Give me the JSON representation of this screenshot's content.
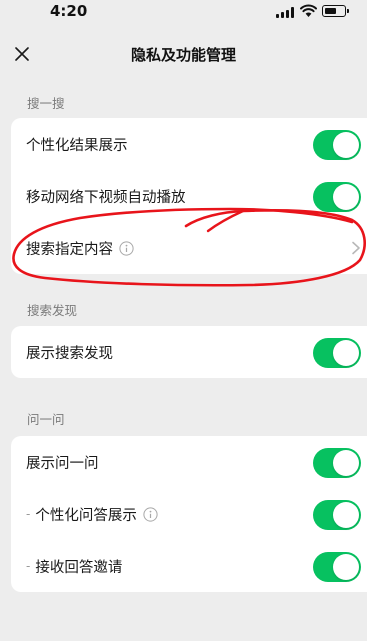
{
  "status_bar": {
    "time": "4:20",
    "signal_icon": "signal-icon",
    "wifi_icon": "wifi-icon",
    "battery_icon": "battery-icon",
    "battery_level": 0.6
  },
  "nav": {
    "title": "隐私及功能管理",
    "close_icon": "close-icon"
  },
  "sections": [
    {
      "header": "搜一搜",
      "rows": [
        {
          "label": "个性化结果展示",
          "control": "toggle",
          "on": true
        },
        {
          "label": "移动网络下视频自动播放",
          "control": "toggle",
          "on": true
        },
        {
          "label": "搜索指定内容",
          "control": "chevron",
          "info_icon": true
        }
      ]
    },
    {
      "header": "搜索发现",
      "rows": [
        {
          "label": "展示搜索发现",
          "control": "toggle",
          "on": true
        }
      ]
    },
    {
      "header": "问一问",
      "rows": [
        {
          "label": "展示问一问",
          "control": "toggle",
          "on": true
        },
        {
          "prefix": "-",
          "label": "个性化问答展示",
          "control": "toggle",
          "on": true,
          "info_icon": true
        },
        {
          "prefix": "-",
          "label": "接收回答邀请",
          "control": "toggle",
          "on": true
        }
      ]
    }
  ],
  "colors": {
    "toggle_on": "#07c160",
    "background": "#ededed",
    "annotation": "#e8141b"
  }
}
